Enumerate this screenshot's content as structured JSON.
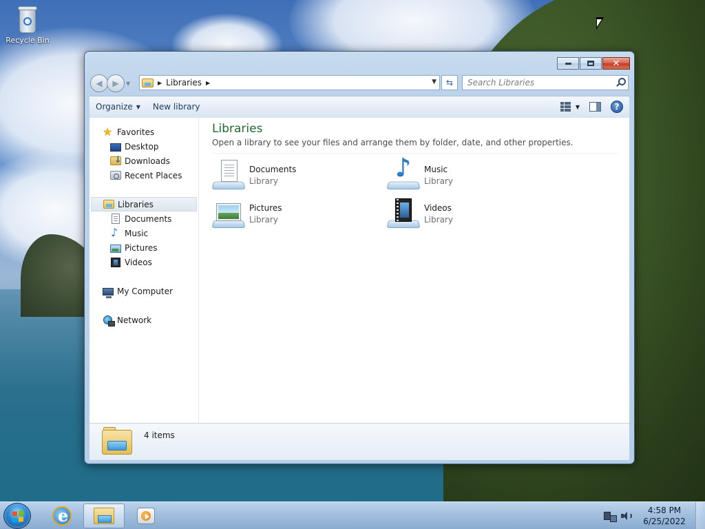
{
  "desktop": {
    "icons": [
      {
        "label": "Recycle Bin",
        "icon": "recycle-bin-icon"
      }
    ]
  },
  "window": {
    "caption_buttons": [
      "minimize",
      "maximize",
      "close"
    ],
    "close_glyph": "✕",
    "address": {
      "crumb": "Libraries",
      "icon": "libraries-folder-icon"
    },
    "search": {
      "placeholder": "Search Libraries"
    },
    "toolbar": {
      "organize_label": "Organize",
      "new_library_label": "New library",
      "help_glyph": "?"
    },
    "nav": {
      "favorites": {
        "label": "Favorites",
        "items": [
          {
            "label": "Desktop",
            "icon": "desktop-icon"
          },
          {
            "label": "Downloads",
            "icon": "downloads-icon"
          },
          {
            "label": "Recent Places",
            "icon": "recent-places-icon"
          }
        ]
      },
      "libraries": {
        "label": "Libraries",
        "selected": true,
        "items": [
          {
            "label": "Documents",
            "icon": "documents-icon"
          },
          {
            "label": "Music",
            "icon": "music-icon"
          },
          {
            "label": "Pictures",
            "icon": "pictures-icon"
          },
          {
            "label": "Videos",
            "icon": "videos-icon"
          }
        ]
      },
      "computer": {
        "label": "My Computer",
        "icon": "computer-icon"
      },
      "network": {
        "label": "Network",
        "icon": "network-icon"
      }
    },
    "main": {
      "title": "Libraries",
      "subtitle": "Open a library to see your files and arrange them by folder, date, and other properties.",
      "items": [
        {
          "name": "Documents",
          "type": "Library",
          "icon": "documents-library-icon"
        },
        {
          "name": "Music",
          "type": "Library",
          "icon": "music-library-icon"
        },
        {
          "name": "Pictures",
          "type": "Library",
          "icon": "pictures-library-icon"
        },
        {
          "name": "Videos",
          "type": "Library",
          "icon": "videos-library-icon"
        }
      ]
    },
    "details": {
      "count": "4 items"
    },
    "colors": {
      "title_green": "#1e6b2e",
      "close_red": "#c13d22"
    }
  },
  "taskbar": {
    "pinned": [
      {
        "name": "start-button",
        "icon": "windows-logo-icon"
      },
      {
        "name": "internet-explorer",
        "icon": "internet-explorer-icon"
      },
      {
        "name": "windows-explorer",
        "icon": "folder-icon",
        "active": true
      },
      {
        "name": "media-player",
        "icon": "media-player-icon"
      }
    ],
    "clock": {
      "time": "4:58 PM",
      "date": "6/25/2022"
    }
  }
}
